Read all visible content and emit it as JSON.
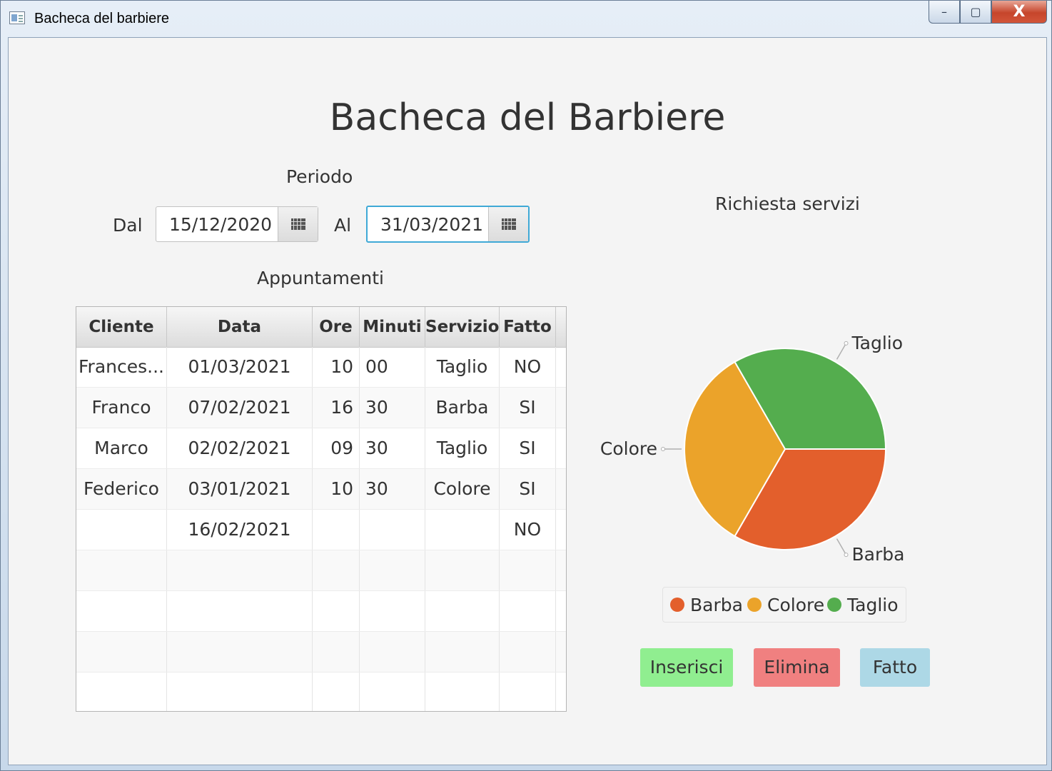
{
  "window": {
    "title": "Bacheca del barbiere",
    "minimize": "–",
    "maximize": "▢",
    "close": "X"
  },
  "header": {
    "title": "Bacheca del Barbiere"
  },
  "period": {
    "label": "Periodo",
    "from_label": "Dal",
    "from_value": "15/12/2020",
    "to_label": "Al",
    "to_value": "31/03/2021"
  },
  "appointments": {
    "label": "Appuntamenti",
    "columns": [
      "Cliente",
      "Data",
      "Ore",
      "Minuti",
      "Servizio",
      "Fatto"
    ],
    "rows": [
      [
        "Frances...",
        "01/03/2021",
        "10",
        "00",
        "Taglio",
        "NO"
      ],
      [
        "Franco",
        "07/02/2021",
        "16",
        "30",
        "Barba",
        "SI"
      ],
      [
        "Marco",
        "02/02/2021",
        "09",
        "30",
        "Taglio",
        "SI"
      ],
      [
        "Federico",
        "03/01/2021",
        "10",
        "30",
        "Colore",
        "SI"
      ],
      [
        "",
        "16/02/2021",
        "",
        "",
        "",
        "NO"
      ]
    ]
  },
  "chart": {
    "title": "Richiesta servizi"
  },
  "chart_data": {
    "type": "pie",
    "title": "Richiesta servizi",
    "labels": [
      "Barba",
      "Colore",
      "Taglio"
    ],
    "values": [
      1,
      1,
      1
    ],
    "colors": [
      "#e35f2c",
      "#eba32a",
      "#54ad4e"
    ],
    "legend": "bottom"
  },
  "buttons": {
    "insert": "Inserisci",
    "delete": "Elimina",
    "done": "Fatto"
  },
  "colors": {
    "insert_bg": "#90ee90",
    "delete_bg": "#f08080",
    "done_bg": "#add8e6"
  }
}
